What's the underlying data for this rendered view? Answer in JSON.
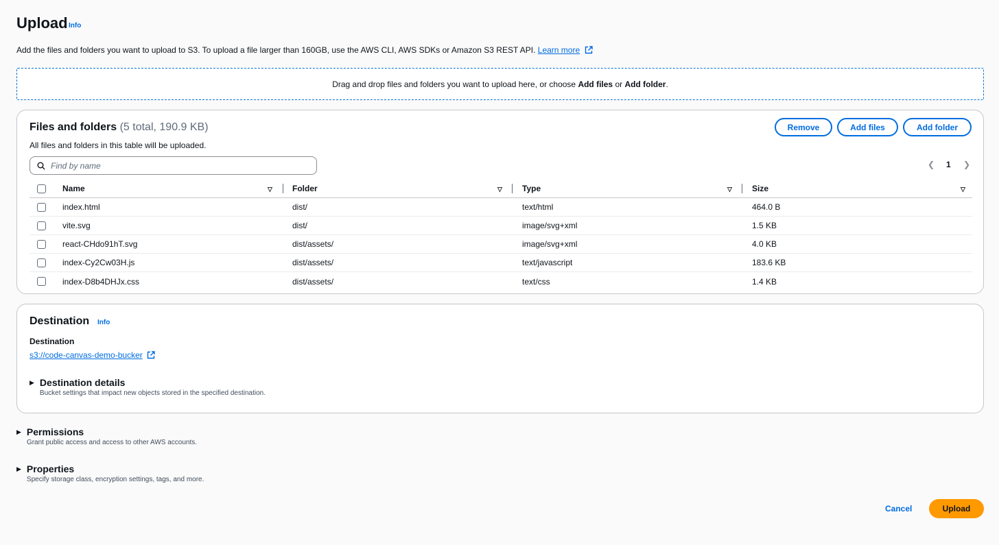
{
  "header": {
    "title": "Upload",
    "info_label": "Info",
    "description": "Add the files and folders you want to upload to S3. To upload a file larger than 160GB, use the AWS CLI, AWS SDKs or Amazon S3 REST API.",
    "learn_more": "Learn more"
  },
  "dropzone": {
    "text_before": "Drag and drop files and folders you want to upload here, or choose ",
    "add_files": "Add files",
    "or": " or ",
    "add_folder": "Add folder",
    "period": "."
  },
  "files": {
    "heading": "Files and folders",
    "count": "(5 total, 190.9 KB)",
    "subtext": "All files and folders in this table will be uploaded.",
    "buttons": {
      "remove": "Remove",
      "add_files": "Add files",
      "add_folder": "Add folder"
    },
    "search_placeholder": "Find by name",
    "page": "1",
    "columns": [
      "Name",
      "Folder",
      "Type",
      "Size"
    ],
    "rows": [
      {
        "name": "index.html",
        "folder": "dist/",
        "type": "text/html",
        "size": "464.0 B"
      },
      {
        "name": "vite.svg",
        "folder": "dist/",
        "type": "image/svg+xml",
        "size": "1.5 KB"
      },
      {
        "name": "react-CHdo91hT.svg",
        "folder": "dist/assets/",
        "type": "image/svg+xml",
        "size": "4.0 KB"
      },
      {
        "name": "index-Cy2Cw03H.js",
        "folder": "dist/assets/",
        "type": "text/javascript",
        "size": "183.6 KB"
      },
      {
        "name": "index-D8b4DHJx.css",
        "folder": "dist/assets/",
        "type": "text/css",
        "size": "1.4 KB"
      }
    ]
  },
  "destination": {
    "heading": "Destination",
    "info_label": "Info",
    "label": "Destination",
    "url": "s3://code-canvas-demo-bucker",
    "details_title": "Destination details",
    "details_desc": "Bucket settings that impact new objects stored in the specified destination."
  },
  "permissions": {
    "title": "Permissions",
    "desc": "Grant public access and access to other AWS accounts."
  },
  "properties": {
    "title": "Properties",
    "desc": "Specify storage class, encryption settings, tags, and more."
  },
  "footer": {
    "cancel": "Cancel",
    "upload": "Upload"
  },
  "colors": {
    "link": "#006ce0",
    "primary_button": "#ff9900"
  }
}
